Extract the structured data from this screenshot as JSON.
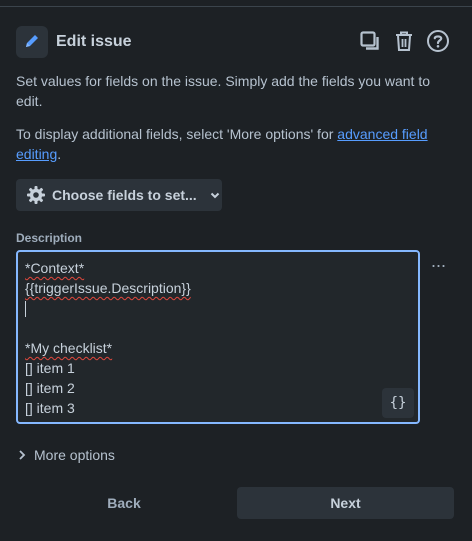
{
  "header": {
    "title": "Edit issue",
    "icons": [
      "pencil-icon",
      "copy-icon",
      "trash-icon",
      "help-icon"
    ]
  },
  "intro": {
    "line1": "Set values for fields on the issue. Simply add the fields you want to edit.",
    "line2_prefix": "To display additional fields, select 'More options' for ",
    "line2_link": "advanced field editing",
    "line2_suffix": "."
  },
  "choose_fields": {
    "label": "Choose fields to set...",
    "icon": "gear-icon"
  },
  "description": {
    "label": "Description",
    "lines": [
      "*Context*",
      "{{triggerIssue.Description}}",
      "",
      "",
      "*My checklist*",
      "[] item 1",
      "[] item 2",
      "[] item 3"
    ],
    "smart_values_button": "{}",
    "more_icon": "···"
  },
  "more_options": {
    "label": "More options"
  },
  "footer": {
    "back": "Back",
    "next": "Next"
  },
  "colors": {
    "accent": "#579dff",
    "focus_border": "#85b8ff",
    "background": "#1d2125"
  }
}
